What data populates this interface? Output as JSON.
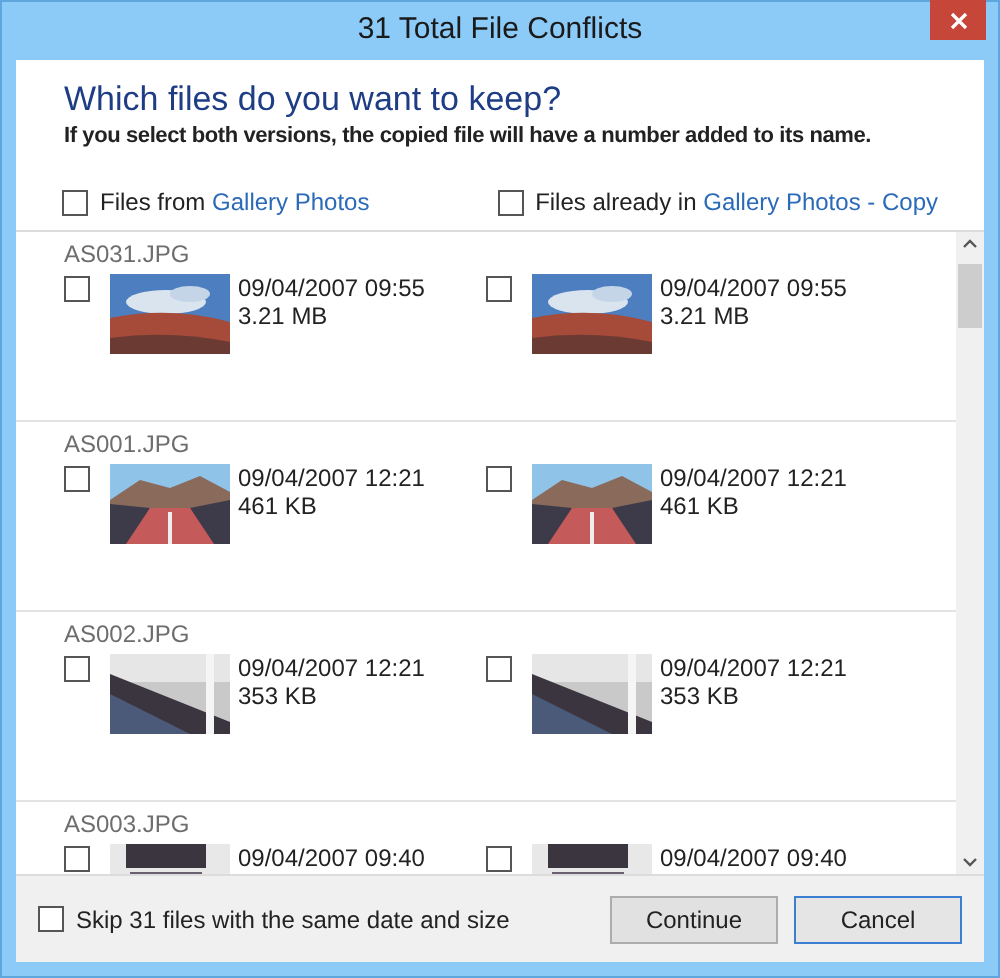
{
  "window": {
    "title": "31 Total File Conflicts"
  },
  "heading": "Which files do you want to keep?",
  "subtitle": "If you select both versions, the copied file will have a number added to its name.",
  "sources": [
    {
      "prefix": "Files from",
      "link": "Gallery Photos",
      "checked": false
    },
    {
      "prefix": "Files already in",
      "link": "Gallery Photos - Copy",
      "checked": false
    }
  ],
  "files": [
    {
      "name": "AS031.JPG",
      "versions": [
        {
          "date": "09/04/2007 09:55",
          "size": "3.21 MB",
          "checked": false
        },
        {
          "date": "09/04/2007 09:55",
          "size": "3.21 MB",
          "checked": false
        }
      ]
    },
    {
      "name": "AS001.JPG",
      "versions": [
        {
          "date": "09/04/2007 12:21",
          "size": "461 KB",
          "checked": false
        },
        {
          "date": "09/04/2007 12:21",
          "size": "461 KB",
          "checked": false
        }
      ]
    },
    {
      "name": "AS002.JPG",
      "versions": [
        {
          "date": "09/04/2007 12:21",
          "size": "353 KB",
          "checked": false
        },
        {
          "date": "09/04/2007 12:21",
          "size": "353 KB",
          "checked": false
        }
      ]
    },
    {
      "name": "AS003.JPG",
      "versions": [
        {
          "date": "09/04/2007 09:40",
          "checked": false
        },
        {
          "date": "09/04/2007 09:40",
          "checked": false
        }
      ]
    }
  ],
  "skip": {
    "label": "Skip 31 files with the same date and size",
    "checked": false
  },
  "buttons": [
    {
      "label": "Continue",
      "default": false
    },
    {
      "label": "Cancel",
      "default": true
    }
  ]
}
